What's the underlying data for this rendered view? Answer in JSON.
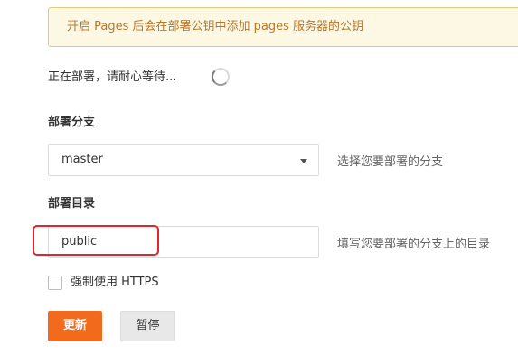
{
  "notice": {
    "text": "开启 Pages 后会在部署公钥中添加 pages 服务器的公钥"
  },
  "status": {
    "deploying_text": "正在部署，请耐心等待..."
  },
  "branch": {
    "label": "部署分支",
    "value": "master",
    "hint": "选择您要部署的分支"
  },
  "directory": {
    "label": "部署目录",
    "value": "public",
    "hint": "填写您要部署的分支上的目录"
  },
  "force_https": {
    "label": "强制使用 HTTPS",
    "checked": false
  },
  "buttons": {
    "update": "更新",
    "pause": "暂停"
  },
  "colors": {
    "accent": "#f26b1d",
    "highlight": "#e0262c",
    "notice_bg": "#fcf8e3",
    "notice_text": "#b8762c"
  }
}
